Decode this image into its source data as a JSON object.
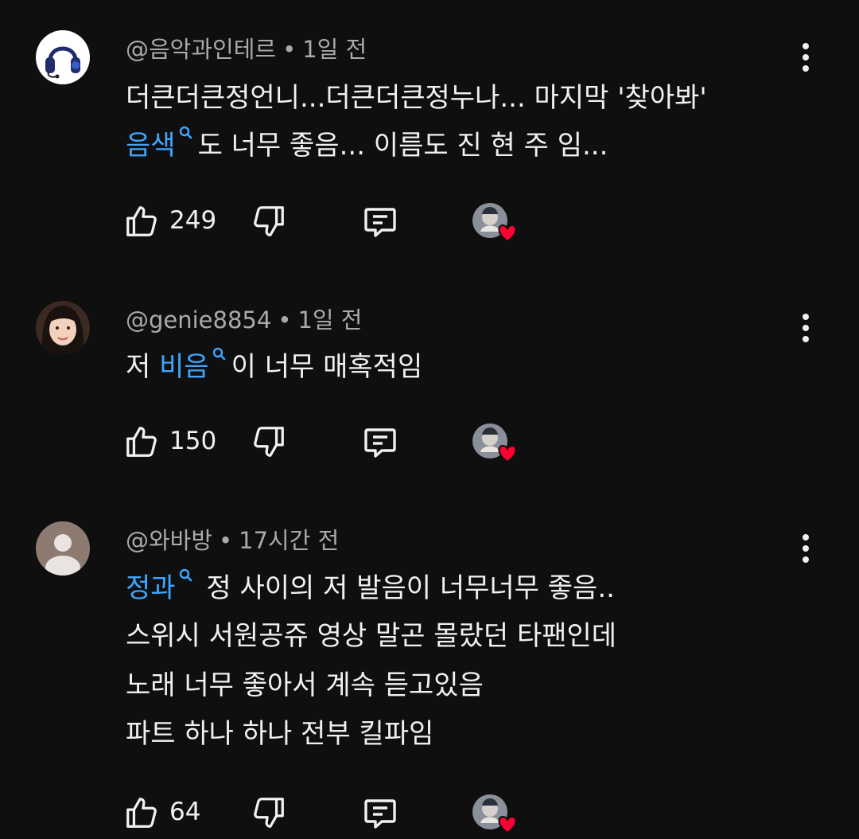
{
  "comments": [
    {
      "avatar": "headphones-avatar",
      "handle": "@음악과인테르",
      "separator": "•",
      "time": "1일 전",
      "lines": [
        {
          "text": "더큰더큰정언니...더큰더큰정누나... 마지막 '찾아봐'"
        },
        {
          "link": "음색",
          "text": "도 너무 좋음... 이름도 진 현 주 임..."
        }
      ],
      "likes": "249"
    },
    {
      "avatar": "person-photo-avatar",
      "handle": "@genie8854",
      "separator": "•",
      "time": "1일 전",
      "lines": [
        {
          "prefix": "저 ",
          "link": "비음",
          "text": "이 너무 매혹적임"
        }
      ],
      "likes": "150"
    },
    {
      "avatar": "default-user-avatar",
      "handle": "@와바방",
      "separator": "•",
      "time": "17시간 전",
      "lines": [
        {
          "link": "정과",
          "text": " 정 사이의 저 발음이 너무너무 좋음.."
        },
        {
          "text": "스위시 서원공쥬 영상 말곤 몰랐던 타팬인데"
        },
        {
          "text": "노래 너무 좋아서 계속 듣고있음"
        },
        {
          "text": "파트 하나 하나 전부 킬파임"
        }
      ],
      "likes": "64"
    }
  ],
  "icons": {
    "like": "thumbs-up-icon",
    "dislike": "thumbs-down-icon",
    "reply": "reply-icon",
    "more": "more-vertical-icon",
    "search": "search-icon",
    "creator_heart": "creator-heart-badge"
  },
  "colors": {
    "background": "#0f0f0f",
    "text": "#f1f1f1",
    "meta": "#aaaaaa",
    "link": "#3ea6ff",
    "heart": "#ff0033"
  }
}
